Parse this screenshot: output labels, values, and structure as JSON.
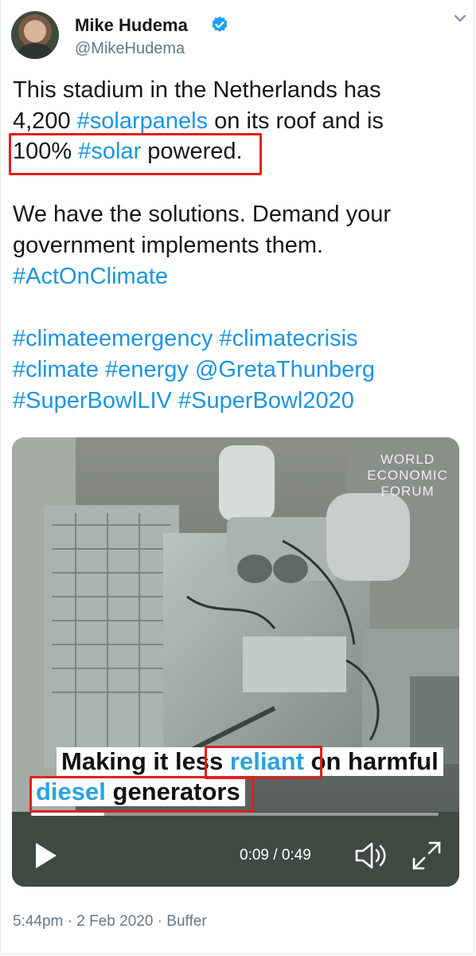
{
  "user": {
    "name": "Mike Hudema",
    "handle": "@MikeHudema"
  },
  "tweet": {
    "line1": "This stadium in the Netherlands has",
    "line2_pre": "4,200 ",
    "line2_tag": "#solarpanels",
    "line2_post": " on its roof and is",
    "line3_pre": "100% ",
    "line3_tag": "#solar",
    "line3_post": " powered.",
    "line4": "We have the solutions. Demand your",
    "line5": "government implements them.",
    "line6_tag": "#ActOnClimate",
    "line7_tag1": "#climateemergency",
    "line7_tag2": "#climatecrisis",
    "line8_tag1": "#climate",
    "line8_tag2": "#energy",
    "line8_mention": "@GretaThunberg",
    "line9_tag1": "#SuperBowlLIV",
    "line9_tag2": "#SuperBowl2020"
  },
  "video": {
    "watermark_line1": "WORLD",
    "watermark_line2": "ECONOMIC",
    "watermark_line3": "FORUM",
    "caption1_pre": "Making it less ",
    "caption1_word": "reliant",
    "caption1_post": " on harmful",
    "caption2_word": "diesel",
    "caption2_post": " generators",
    "time": "0:09 / 0:49",
    "progress": 0.18
  },
  "footer": {
    "time": "5:44pm",
    "date": "2 Feb 2020",
    "source": "Buffer",
    "sep": " · "
  },
  "colors": {
    "link": "#1b95e0",
    "highlight": "#e0201b",
    "verified": "#1da1f2"
  }
}
